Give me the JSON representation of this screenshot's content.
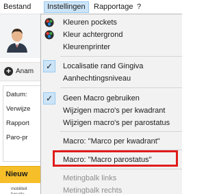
{
  "menubar": {
    "items": [
      {
        "label": "Bestand"
      },
      {
        "label": "Instellingen"
      },
      {
        "label": "Rapportage"
      },
      {
        "label": "?"
      }
    ]
  },
  "background": {
    "add_label": "Anam",
    "info_labels": [
      "Datum:",
      "Verwijze",
      "Rapport",
      "Paro-pr"
    ],
    "tab_label": "Nieuw",
    "footer_text": [
      "mobiliteit",
      "furcatie"
    ]
  },
  "dropdown": {
    "items": [
      {
        "label": "Kleuren pockets",
        "icon": "palette-icon",
        "checked": false,
        "disabled": false
      },
      {
        "label": "Kleur achtergrond",
        "icon": "palette-icon",
        "checked": false,
        "disabled": false
      },
      {
        "label": "Kleurenprinter",
        "icon": "",
        "checked": false,
        "disabled": false
      },
      {
        "label": "Localisatie rand Gingiva",
        "icon": "",
        "checked": true,
        "disabled": false
      },
      {
        "label": "Aanhechtingsniveau",
        "icon": "",
        "checked": false,
        "disabled": false
      },
      {
        "label": "Geen Macro gebruiken",
        "icon": "",
        "checked": true,
        "disabled": false
      },
      {
        "label": "Wijzigen macro's per kwadrant",
        "icon": "",
        "checked": false,
        "disabled": false
      },
      {
        "label": "Wijzigen macro's per parostatus",
        "icon": "",
        "checked": false,
        "disabled": false
      },
      {
        "label": "Macro: \"Marco per kwadrant\"",
        "icon": "",
        "checked": false,
        "disabled": false
      },
      {
        "label": "Macro: \"Macro parostatus\"",
        "icon": "",
        "checked": false,
        "disabled": false
      },
      {
        "label": "Metingbalk links",
        "icon": "",
        "checked": false,
        "disabled": true
      },
      {
        "label": "Metingbalk rechts",
        "icon": "",
        "checked": false,
        "disabled": true
      }
    ],
    "check_glyph": "✓"
  },
  "colors": {
    "highlight": "#e01b1b",
    "selection": "#cce4f7",
    "tab": "#f6bf2a"
  }
}
